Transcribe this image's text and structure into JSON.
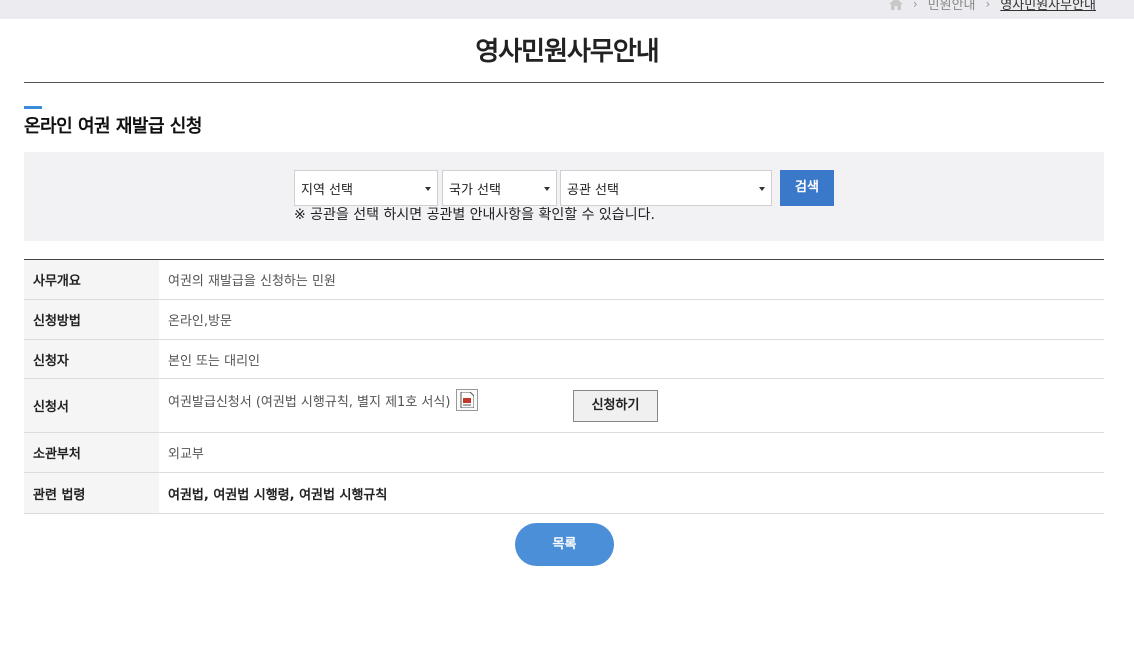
{
  "breadcrumb": {
    "home_icon": "home-icon",
    "items": [
      "민원안내",
      "영사민원사무안내"
    ]
  },
  "page_title": "영사민원사무안내",
  "section_title": "온라인 여권 재발급 신청",
  "search": {
    "region_select": "지역 선택",
    "country_select": "국가 선택",
    "office_select": "공관 선택",
    "search_button": "검색",
    "note": "※ 공관을 선택 하시면 공관별 안내사항을 확인할 수 있습니다."
  },
  "table": {
    "rows": [
      {
        "label": "사무개요",
        "value": "여권의 재발급을 신청하는 민원"
      },
      {
        "label": "신청방법",
        "value": "온라인,방문"
      },
      {
        "label": "신청자",
        "value": "본인 또는 대리인"
      },
      {
        "label": "신청서",
        "value": "여권발급신청서 (여권법 시행규칙, 별지 제1호 서식)",
        "icon": "document-icon",
        "button": "신청하기"
      },
      {
        "label": "소관부처",
        "value": "외교부"
      },
      {
        "label": "관련 법령",
        "value": "여권법, 여권법 시행령, 여권법 시행규칙"
      }
    ]
  },
  "list_button": "목록",
  "colors": {
    "accent": "#3a8ad6",
    "search_button": "#3a78c9",
    "list_button": "#4a8fd8"
  }
}
